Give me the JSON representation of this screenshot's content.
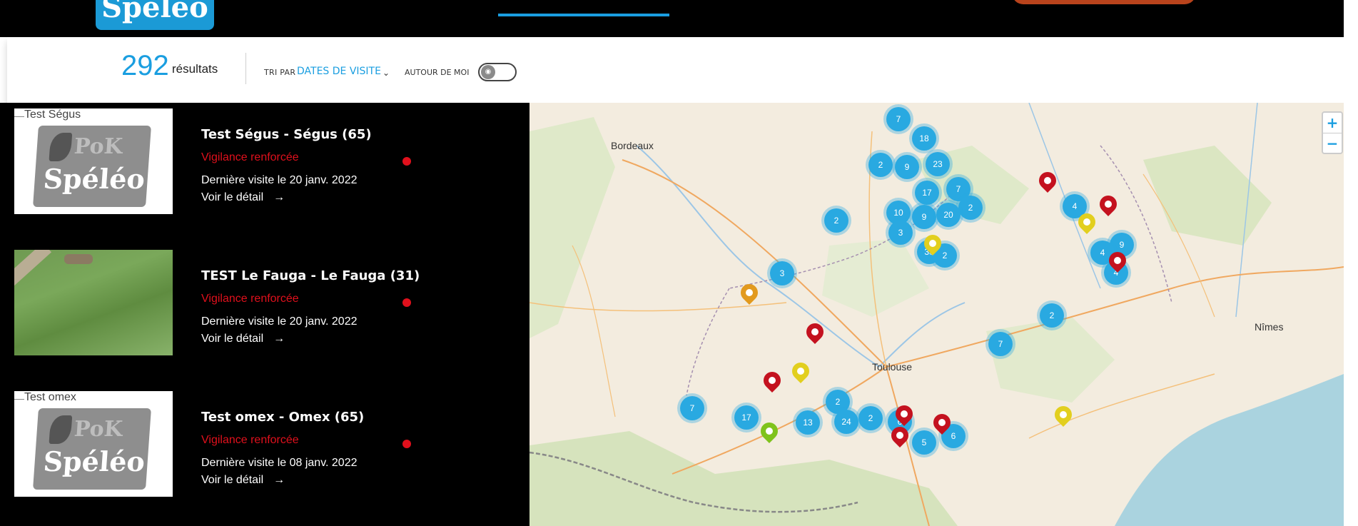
{
  "header": {
    "logo_text": "Spéléo"
  },
  "results": {
    "count": "292",
    "label": "résultats",
    "sort_prefix": "TRI PAR",
    "sort_value": "DATES DE VISITE",
    "nearby_label": "AUTOUR DE MOI"
  },
  "cards": [
    {
      "image_alt": "Test Ségus",
      "title": "Test Ségus - Ségus (65)",
      "status": "Vigilance renforcée",
      "visit": "Dernière visite le 20 janv. 2022",
      "detail": "Voir le détail"
    },
    {
      "image_alt": "",
      "title": "TEST Le Fauga - Le Fauga (31)",
      "status": "Vigilance renforcée",
      "visit": "Dernière visite le 20 janv. 2022",
      "detail": "Voir le détail"
    },
    {
      "image_alt": "Test omex",
      "title": "Test omex - Omex (65)",
      "status": "Vigilance renforcée",
      "visit": "Dernière visite le 08 janv. 2022",
      "detail": "Voir le détail"
    }
  ],
  "logo_small": {
    "top": "PoK",
    "bottom": "Spéléo"
  },
  "map": {
    "cities": [
      "Bordeaux",
      "Toulouse",
      "Nîmes"
    ],
    "clusters": [
      "7",
      "18",
      "2",
      "9",
      "23",
      "7",
      "17",
      "2",
      "10",
      "9",
      "20",
      "2",
      "3",
      "33",
      "2",
      "3",
      "4",
      "9",
      "4",
      "4",
      "2",
      "7",
      "7",
      "17",
      "13",
      "2",
      "24",
      "2",
      "6",
      "5",
      "6"
    ],
    "zoom_in": "+",
    "zoom_out": "−",
    "colors": {
      "cluster": "#29a9e1",
      "red_pin": "#c4121f",
      "yellow_pin": "#e2cf1e",
      "orange_pin": "#e29a1e",
      "green_pin": "#7fc31c"
    }
  }
}
